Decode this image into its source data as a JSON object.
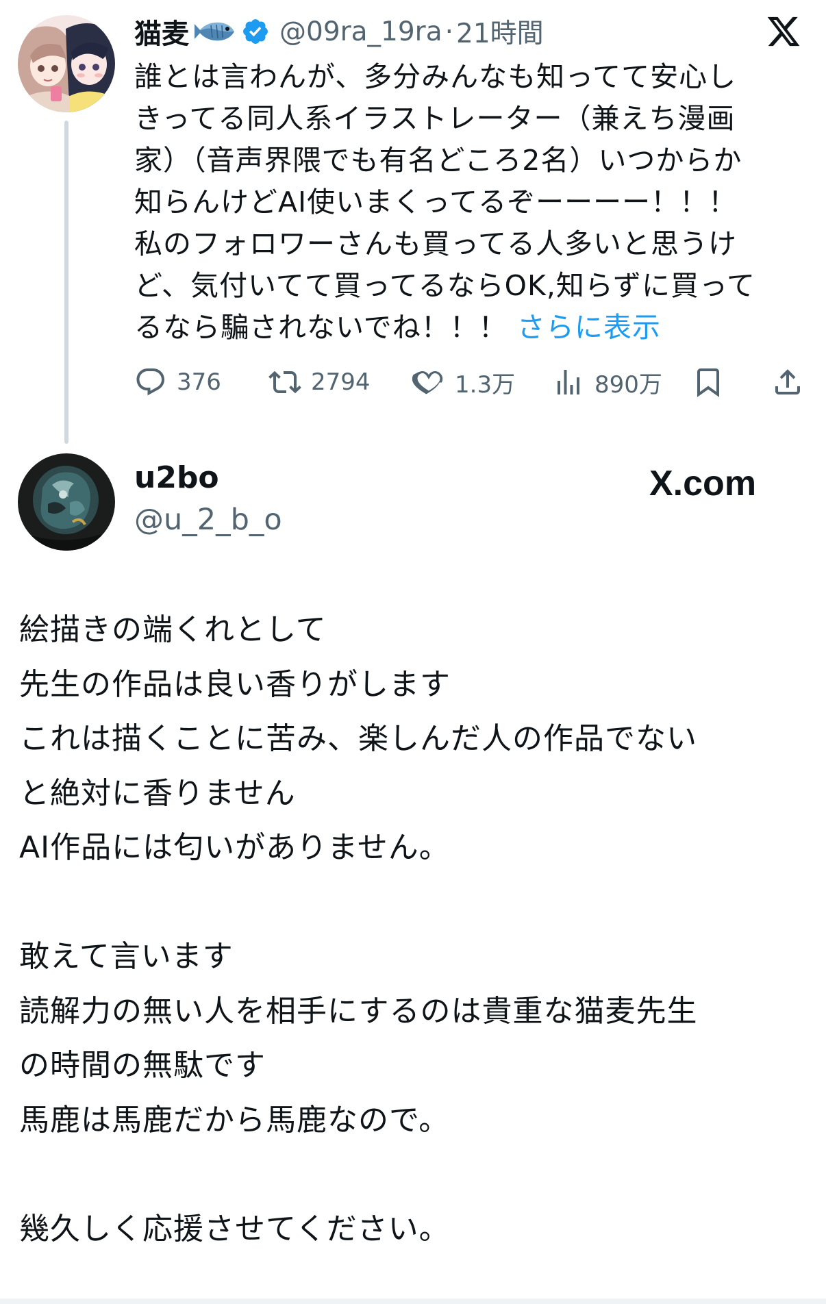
{
  "tweet": {
    "author": {
      "display_name": "猫麦",
      "emoji_icon": "fish-emoji-icon",
      "verified_icon": "verified-badge-icon",
      "handle": "@09ra_19ra",
      "separator": "·",
      "time": "21時間"
    },
    "text_lines": [
      "誰とは言わんが、多分みんなも知ってて安心し",
      "きってる同人系イラストレーター（兼えち漫画",
      "家）（音声界隈でも有名どころ2名）いつからか",
      "知らんけどAI使いまくってるぞーーーー！！！",
      "私のフォロワーさんも買ってる人多いと思うけ",
      "ど、気付いてて買ってるならOK,知らずに買って"
    ],
    "last_line": "るなら騙されないでね！！！",
    "show_more": "さらに表示",
    "actions": {
      "replies": "376",
      "reposts": "2794",
      "likes": "1.3万",
      "views": "890万"
    },
    "accent_color": "#1d9bf0",
    "muted_color": "#536471"
  },
  "reply_card": {
    "author": {
      "display_name": "u2bo",
      "handle": "@u_2_b_o"
    },
    "brand": "X.com",
    "text_lines": [
      "絵描きの端くれとして",
      "先生の作品は良い香りがします",
      "これは描くことに苦み、楽しんだ人の作品でない",
      "と絶対に香りません",
      "AI作品には匂いがありません。",
      "",
      "敢えて言います",
      "読解力の無い人を相手にするのは貴重な猫麦先生",
      "の時間の無駄です",
      "馬鹿は馬鹿だから馬鹿なので。",
      "",
      "幾久しく応援させてください。"
    ]
  }
}
